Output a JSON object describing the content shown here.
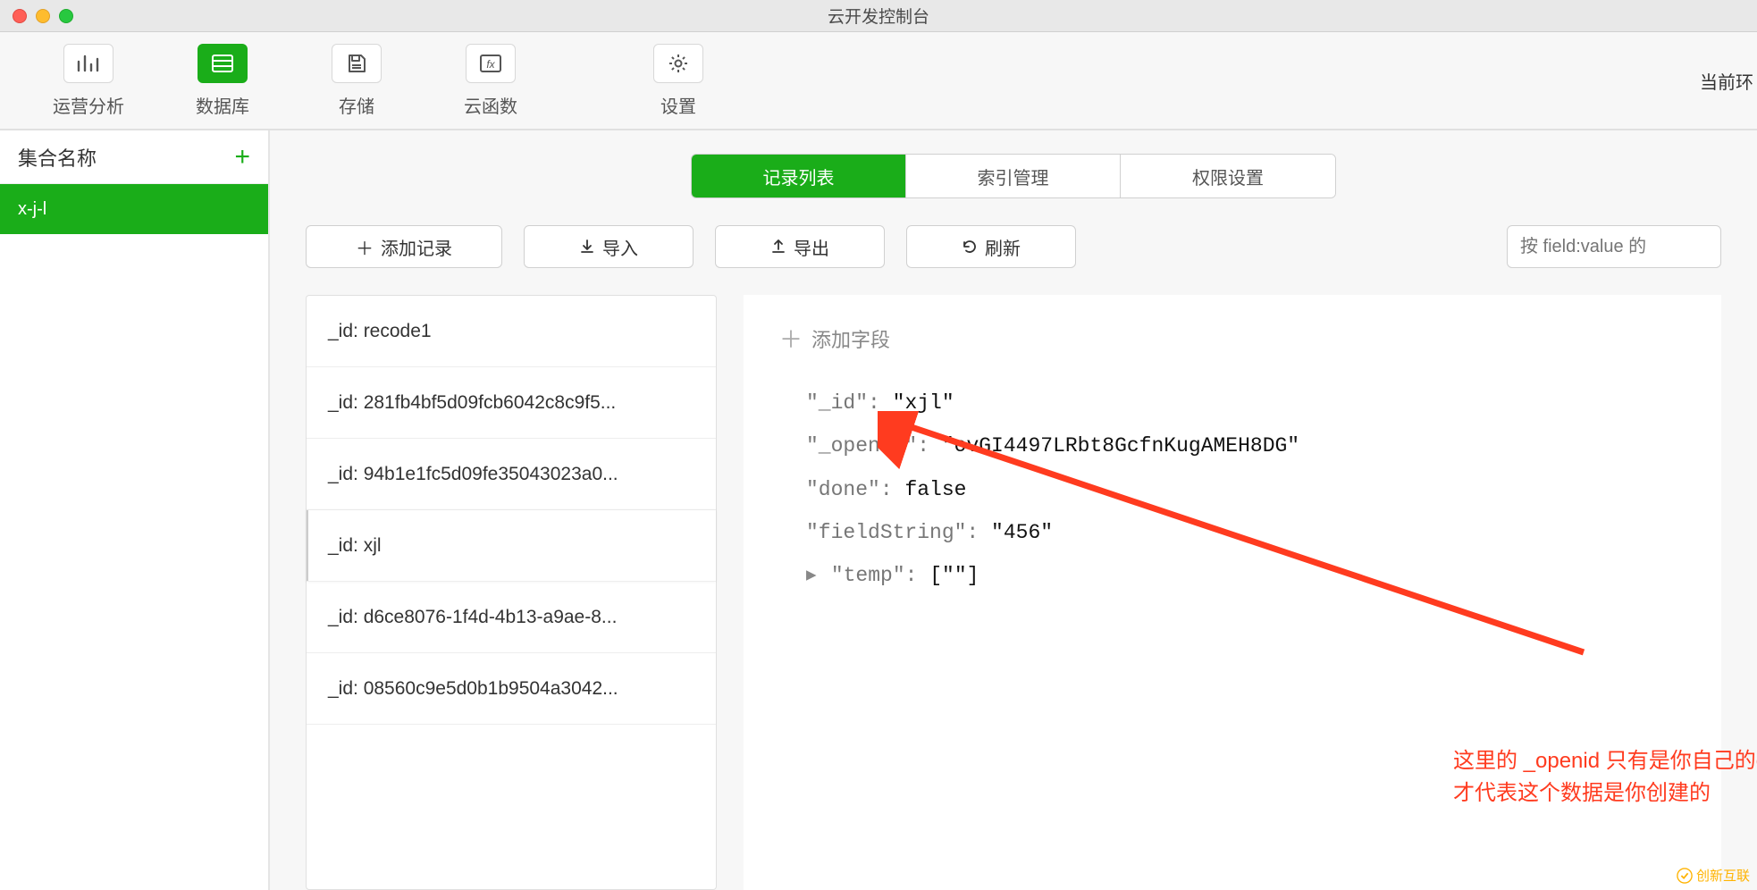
{
  "window": {
    "title": "云开发控制台"
  },
  "toolbar": {
    "items": [
      {
        "label": "运营分析"
      },
      {
        "label": "数据库"
      },
      {
        "label": "存储"
      },
      {
        "label": "云函数"
      },
      {
        "label": "设置"
      }
    ],
    "env_label": "当前环"
  },
  "sidebar": {
    "header": "集合名称",
    "collections": [
      {
        "name": "x-j-l"
      }
    ]
  },
  "tabs": {
    "items": [
      {
        "label": "记录列表"
      },
      {
        "label": "索引管理"
      },
      {
        "label": "权限设置"
      }
    ]
  },
  "actions": {
    "add_record": "添加记录",
    "import": "导入",
    "export": "导出",
    "refresh": "刷新",
    "search_placeholder": "按 field:value 的"
  },
  "records": [
    {
      "label": "_id: recode1"
    },
    {
      "label": "_id: 281fb4bf5d09fcb6042c8c9f5..."
    },
    {
      "label": "_id: 94b1e1fc5d09fe35043023a0..."
    },
    {
      "label": "_id: xjl",
      "selected": true
    },
    {
      "label": "_id: d6ce8076-1f4d-4b13-a9ae-8..."
    },
    {
      "label": "_id: 08560c9e5d0b1b9504a3042..."
    }
  ],
  "detail": {
    "add_field_label": "添加字段",
    "fields": {
      "id_key": "\"_id\":",
      "id_val": "\"xjl\"",
      "openid_key": "\"_openid\":",
      "openid_val": "\"ovGI4497LRbt8GcfnKugAMEH8DG\"",
      "done_key": "\"done\":",
      "done_val": "false",
      "fs_key": "\"fieldString\":",
      "fs_val": "\"456\"",
      "temp_key": "\"temp\":",
      "temp_val": "[\"\"]"
    }
  },
  "annotation": "这里的 _openid 只有是你自己的opened时，才代表这个数据是你创建的",
  "watermark": "创新互联"
}
